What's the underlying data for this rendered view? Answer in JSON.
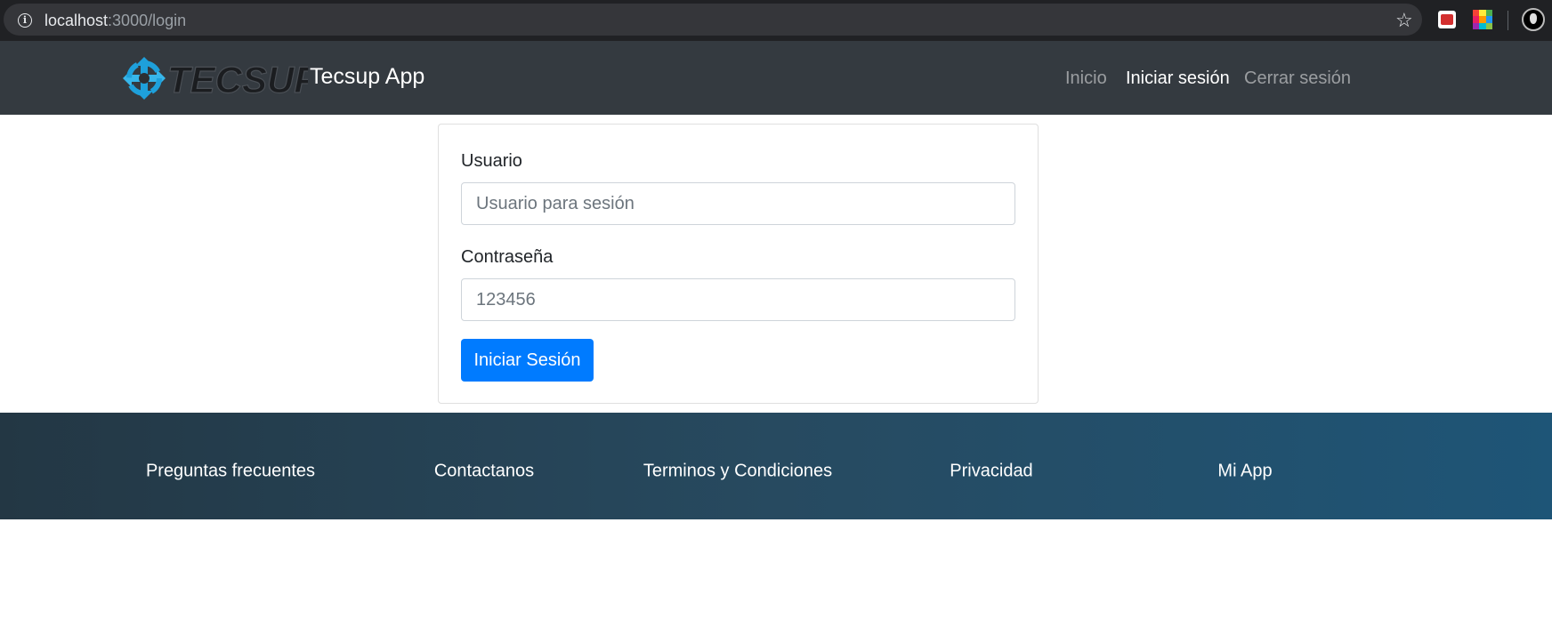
{
  "browser": {
    "url_host": "localhost",
    "url_path": ":3000/login"
  },
  "navbar": {
    "logo_text": "TECSUP",
    "brand": "Tecsup App",
    "links": [
      {
        "label": "Inicio",
        "active": false
      },
      {
        "label": "Iniciar sesión",
        "active": true
      },
      {
        "label": "Cerrar sesión",
        "active": false
      }
    ]
  },
  "login": {
    "username_label": "Usuario",
    "username_placeholder": "Usuario para sesión",
    "username_value": "",
    "password_label": "Contraseña",
    "password_placeholder": "123456",
    "password_value": "",
    "submit_label": "Iniciar Sesión"
  },
  "footer": {
    "links": [
      "Preguntas frecuentes",
      "Contactanos",
      "Terminos y Condiciones",
      "Privacidad",
      "Mi App"
    ]
  },
  "colors": {
    "navbar_bg": "#343a40",
    "primary": "#007bff",
    "footer_gradient_start": "#233744",
    "footer_gradient_end": "#1e5577",
    "logo_blue": "#1ea0db"
  }
}
